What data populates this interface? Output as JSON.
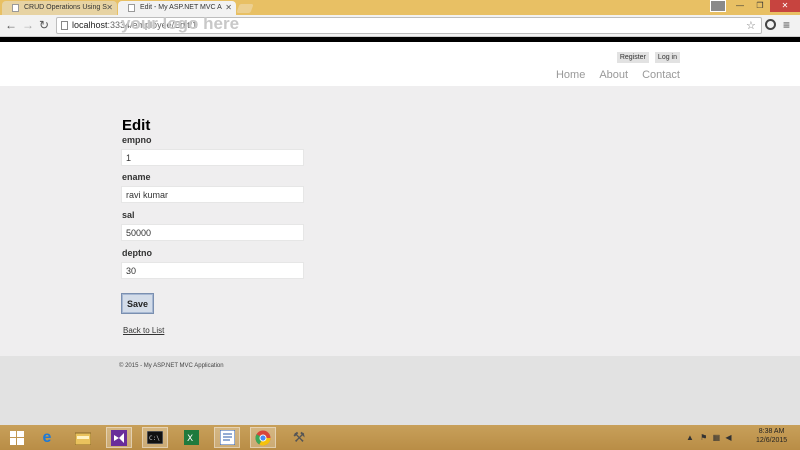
{
  "browser": {
    "tabs": [
      {
        "title": "CRUD Operations Using S"
      },
      {
        "title": "Edit - My ASP.NET MVC A"
      }
    ],
    "address": {
      "host": "localhost",
      "path": ":3334/employee/Edit/1"
    }
  },
  "site": {
    "logo": "your logo here",
    "login_links": {
      "register": "Register",
      "login": "Log in"
    },
    "menu": {
      "home": "Home",
      "about": "About",
      "contact": "Contact"
    }
  },
  "form": {
    "title": "Edit",
    "fields": [
      {
        "label": "empno",
        "value": "1"
      },
      {
        "label": "ename",
        "value": "ravi kumar"
      },
      {
        "label": "sal",
        "value": "50000"
      },
      {
        "label": "deptno",
        "value": "30"
      }
    ],
    "save_label": "Save",
    "back_link": "Back to List"
  },
  "footer": {
    "text": "© 2015 - My ASP.NET MVC Application"
  },
  "taskbar": {
    "icons": [
      "windows-start-icon",
      "internet-explorer-icon",
      "file-explorer-icon",
      "visual-studio-icon",
      "command-prompt-icon",
      "excel-icon",
      "word-icon",
      "chrome-icon",
      "tools-icon"
    ],
    "time": "8:38 AM",
    "date": "12/6/2015"
  }
}
